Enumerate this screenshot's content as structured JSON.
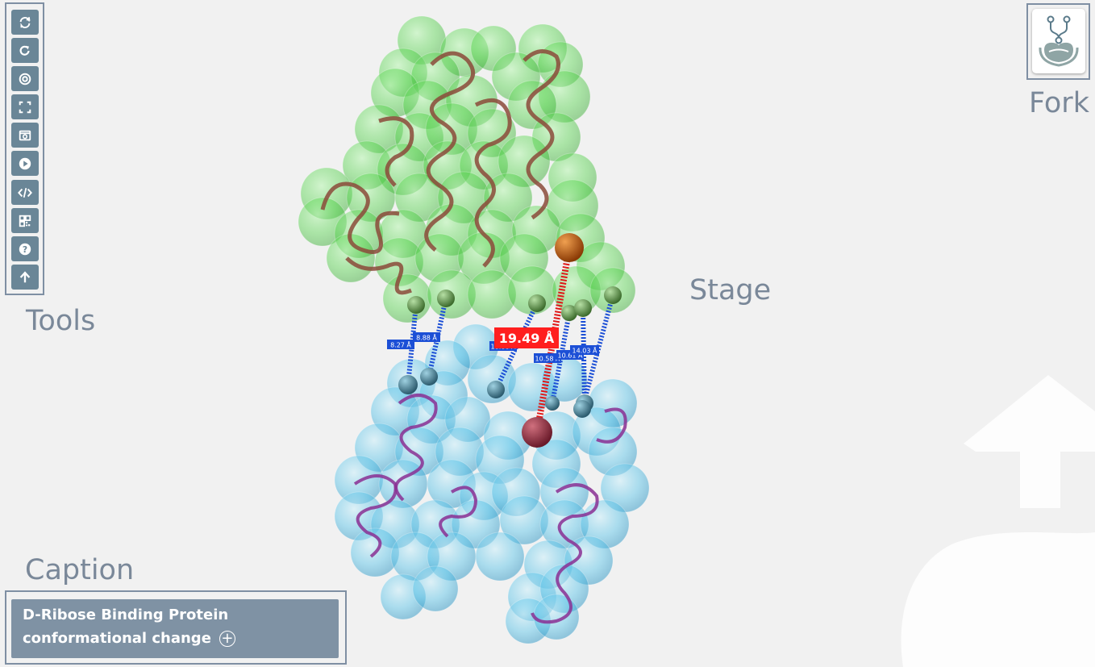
{
  "toolbar": {
    "label": "Tools",
    "buttons": [
      {
        "name": "sync-icon"
      },
      {
        "name": "rotate-icon"
      },
      {
        "name": "center-target-icon"
      },
      {
        "name": "fullscreen-icon"
      },
      {
        "name": "screenshot-icon"
      },
      {
        "name": "play-icon"
      },
      {
        "name": "code-icon"
      },
      {
        "name": "qr-code-icon"
      },
      {
        "name": "help-icon"
      },
      {
        "name": "arrow-up-icon"
      }
    ]
  },
  "stage": {
    "label": "Stage",
    "measurements": {
      "main": "19.49 Å",
      "small": [
        "8.27 Å",
        "8.88 Å",
        "10.66 Å",
        "10.58 Å",
        "10.61 Å",
        "14.03 Å"
      ]
    }
  },
  "fork": {
    "label": "Fork",
    "icon": "fork-logo-icon"
  },
  "caption": {
    "label": "Caption",
    "text": "D-Ribose Binding Protein conformational change",
    "expand_symbol": "+"
  },
  "colors": {
    "button": "#6a8697",
    "border": "#7f8fa3",
    "label": "#7a8899",
    "caption_bg": "#7f92a4",
    "green_domain": "#3ed23e",
    "blue_domain": "#4ab4df",
    "measurement_main": "#ff1f1f",
    "measurement_small": "#1c4fd6"
  }
}
